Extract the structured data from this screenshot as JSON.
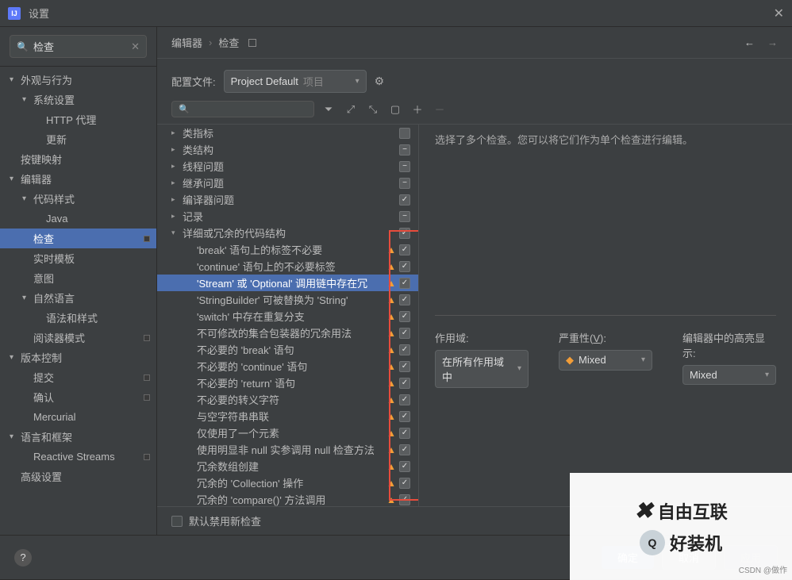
{
  "titlebar": {
    "app_icon": "IJ",
    "title": "设置"
  },
  "sidebar_search": {
    "value": "检查"
  },
  "sidebar": {
    "items": [
      {
        "label": "外观与行为",
        "indent": 0,
        "arrow": "▾"
      },
      {
        "label": "系统设置",
        "indent": 1,
        "arrow": "▾"
      },
      {
        "label": "HTTP 代理",
        "indent": 2
      },
      {
        "label": "更新",
        "indent": 2
      },
      {
        "label": "按键映射",
        "indent": 0
      },
      {
        "label": "编辑器",
        "indent": 0,
        "arrow": "▾"
      },
      {
        "label": "代码样式",
        "indent": 1,
        "arrow": "▾"
      },
      {
        "label": "Java",
        "indent": 2
      },
      {
        "label": "检查",
        "indent": 1,
        "selected": true,
        "marker": true
      },
      {
        "label": "实时模板",
        "indent": 1
      },
      {
        "label": "意图",
        "indent": 1
      },
      {
        "label": "自然语言",
        "indent": 1,
        "arrow": "▾"
      },
      {
        "label": "语法和样式",
        "indent": 2
      },
      {
        "label": "阅读器模式",
        "indent": 1,
        "marker": true
      },
      {
        "label": "版本控制",
        "indent": 0,
        "arrow": "▾"
      },
      {
        "label": "提交",
        "indent": 1,
        "marker": true
      },
      {
        "label": "确认",
        "indent": 1,
        "marker": true
      },
      {
        "label": "Mercurial",
        "indent": 1
      },
      {
        "label": "语言和框架",
        "indent": 0,
        "arrow": "▾"
      },
      {
        "label": "Reactive Streams",
        "indent": 1,
        "marker": true
      },
      {
        "label": "高级设置",
        "indent": 0
      }
    ]
  },
  "breadcrumbs": {
    "a": "编辑器",
    "b": "检查"
  },
  "profile": {
    "label": "配置文件:",
    "select_value": "Project Default",
    "select_sub": "项目"
  },
  "inspections": [
    {
      "label": "类指标",
      "cb": "empty",
      "arrow": "▸"
    },
    {
      "label": "类结构",
      "cb": "mixed",
      "arrow": "▸"
    },
    {
      "label": "线程问题",
      "cb": "mixed",
      "arrow": "▸"
    },
    {
      "label": "继承问题",
      "cb": "mixed",
      "arrow": "▸"
    },
    {
      "label": "编译器问题",
      "cb": "checked",
      "arrow": "▸"
    },
    {
      "label": "记录",
      "cb": "mixed",
      "arrow": "▸"
    },
    {
      "label": "详细或冗余的代码结构",
      "cb": "checked",
      "arrow": "▾"
    },
    {
      "label": "'break' 语句上的标签不必要",
      "cb": "checked",
      "warn": true,
      "indent": 1
    },
    {
      "label": "'continue' 语句上的不必要标签",
      "cb": "checked",
      "warn": true,
      "indent": 1
    },
    {
      "label": "'Stream' 或 'Optional' 调用链中存在冗",
      "cb": "checked",
      "warn": true,
      "indent": 1,
      "selected": true
    },
    {
      "label": "'StringBuilder' 可被替换为 'String'",
      "cb": "checked",
      "warn": true,
      "indent": 1
    },
    {
      "label": "'switch' 中存在重复分支",
      "cb": "checked",
      "warn": true,
      "indent": 1
    },
    {
      "label": "不可修改的集合包装器的冗余用法",
      "cb": "checked",
      "warn": true,
      "indent": 1
    },
    {
      "label": "不必要的 'break' 语句",
      "cb": "checked",
      "warn": true,
      "indent": 1
    },
    {
      "label": "不必要的 'continue' 语句",
      "cb": "checked",
      "warn": true,
      "indent": 1
    },
    {
      "label": "不必要的 'return' 语句",
      "cb": "checked",
      "warn": true,
      "indent": 1
    },
    {
      "label": "不必要的转义字符",
      "cb": "checked",
      "warn": true,
      "indent": 1
    },
    {
      "label": "与空字符串串联",
      "cb": "checked",
      "warn": true,
      "indent": 1
    },
    {
      "label": "仅使用了一个元素",
      "cb": "checked",
      "warn": true,
      "indent": 1
    },
    {
      "label": "使用明显非 null 实参调用 null 检查方法",
      "cb": "checked",
      "warn": true,
      "indent": 1
    },
    {
      "label": "冗余数组创建",
      "cb": "checked",
      "warn": true,
      "indent": 1
    },
    {
      "label": "冗余的 'Collection' 操作",
      "cb": "checked",
      "warn": true,
      "indent": 1
    },
    {
      "label": "冗余的 'compare()' 方法调用",
      "cb": "checked",
      "warn": true,
      "indent": 1
    }
  ],
  "detail": {
    "hint": "选择了多个检查。您可以将它们作为单个检查进行编辑。",
    "scope_label": "作用域:",
    "scope_value": "在所有作用域中",
    "severity_label_pre": "严重性(",
    "severity_label_key": "V",
    "severity_label_post": "):",
    "severity_value": "Mixed",
    "highlight_label": "编辑器中的高亮显示:",
    "highlight_value": "Mixed"
  },
  "bottom_check": {
    "label": "默认禁用新检查"
  },
  "footer": {
    "ok": "确定",
    "cancel": "取消"
  },
  "watermark": {
    "a": "自由互联",
    "b": "好装机",
    "csdn": "CSDN @做作"
  }
}
